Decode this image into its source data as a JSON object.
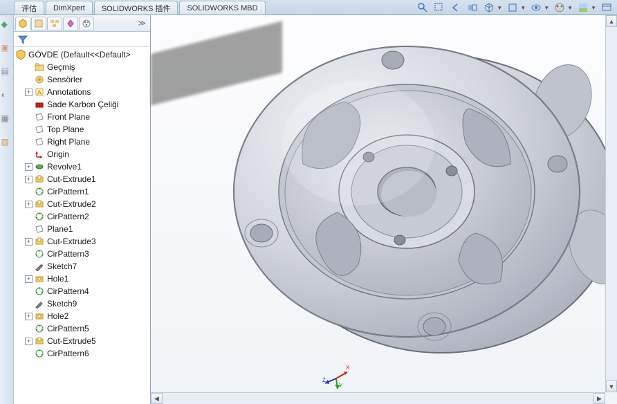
{
  "tabs": {
    "eval": "评估",
    "dimxpert": "DimXpert",
    "plugins": "SOLIDWORKS 插件",
    "mbd": "SOLIDWORKS MBD"
  },
  "tree_root": "GÖVDE  (Default<<Default>",
  "tree": {
    "history": "Geçmiş",
    "sensors": "Sensörler",
    "annotations": "Annotations",
    "material": "Sade Karbon Çeliği",
    "frontplane": "Front Plane",
    "topplane": "Top Plane",
    "rightplane": "Right Plane",
    "origin": "Origin",
    "revolve1": "Revolve1",
    "cutext1": "Cut-Extrude1",
    "cirpat1": "CirPattern1",
    "cutext2": "Cut-Extrude2",
    "cirpat2": "CirPattern2",
    "plane1": "Plane1",
    "cutext3": "Cut-Extrude3",
    "cirpat3": "CirPattern3",
    "sketch7": "Sketch7",
    "hole1": "Hole1",
    "cirpat4": "CirPattern4",
    "sketch9": "Sketch9",
    "hole2": "Hole2",
    "cirpat5": "CirPattern5",
    "cutext5": "Cut-Extrude5",
    "cirpat6": "CirPattern6"
  },
  "coord": {
    "x": "X",
    "y": "Y",
    "z": "Z"
  }
}
